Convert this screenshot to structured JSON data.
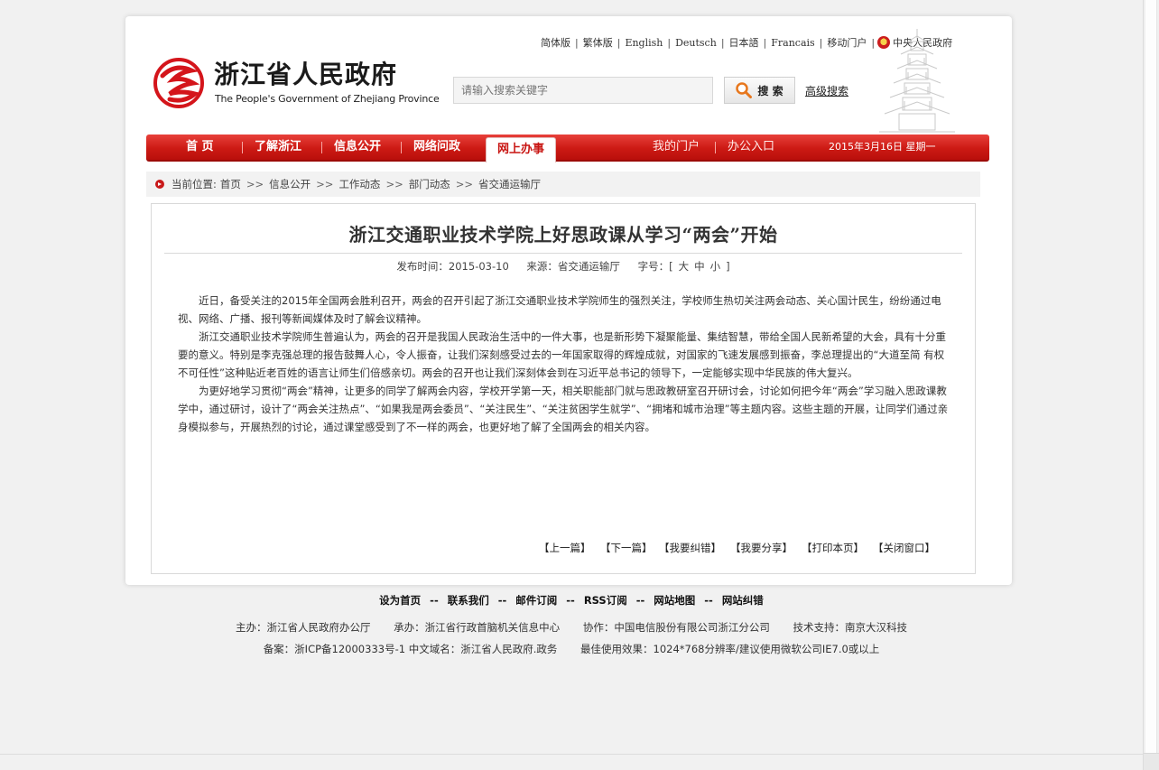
{
  "header": {
    "languages": [
      "简体版",
      "繁体版",
      "English",
      "Deutsch",
      "日本語",
      "Francais",
      "移动门户"
    ],
    "central_gov": "中央人民政府",
    "brand_cn": "浙江省人民政府",
    "brand_en": "The People's Government of Zhejiang Province",
    "search_placeholder": "请输入搜索关键字",
    "search_label": "搜 索",
    "advanced_search": "高级搜索"
  },
  "nav": {
    "items": [
      "首 页",
      "了解浙江",
      "信息公开",
      "网络问政"
    ],
    "active": "网上办事",
    "right_items": [
      "我的门户",
      "办公入口"
    ],
    "date": "2015年3月16日 星期一"
  },
  "breadcrumb": {
    "label": "当前位置:",
    "items": [
      "首页",
      "信息公开",
      "工作动态",
      "部门动态",
      "省交通运输厅"
    ],
    "separator": ">>"
  },
  "article": {
    "title": "浙江交通职业技术学院上好思政课从学习“两会”开始",
    "publish_label": "发布时间：",
    "publish_date": "2015-03-10",
    "source_label": "来源：",
    "source": "省交通运输厅",
    "fontsize_label": "字号：",
    "fontsize_open": "[",
    "fontsize_options": [
      "大",
      "中",
      "小"
    ],
    "fontsize_close": "]",
    "paragraphs": [
      "近日，备受关注的2015年全国两会胜利召开，两会的召开引起了浙江交通职业技术学院师生的强烈关注，学校师生热切关注两会动态、关心国计民生，纷纷通过电视、网络、广播、报刊等新闻媒体及时了解会议精神。",
      "浙江交通职业技术学院师生普遍认为，两会的召开是我国人民政治生活中的一件大事，也是新形势下凝聚能量、集结智慧，带给全国人民新希望的大会，具有十分重要的意义。特别是李克强总理的报告鼓舞人心，令人振奋，让我们深刻感受过去的一年国家取得的辉煌成就，对国家的飞速发展感到振奋，李总理提出的“大道至简 有权不可任性”这种贴近老百姓的语言让师生们倍感亲切。两会的召开也让我们深刻体会到在习近平总书记的领导下，一定能够实现中华民族的伟大复兴。",
      "为更好地学习贯彻“两会”精神，让更多的同学了解两会内容，学校开学第一天，相关职能部门就与思政教研室召开研讨会，讨论如何把今年“两会”学习融入思政课教学中，通过研讨，设计了“两会关注热点”、“如果我是两会委员”、“关注民生”、“关注贫困学生就学”、“拥堵和城市治理”等主题内容。这些主题的开展，让同学们通过亲身模拟参与，开展热烈的讨论，通过课堂感受到了不一样的两会，也更好地了解了全国两会的相关内容。"
    ],
    "actions": [
      "【上一篇】",
      "【下一篇】",
      "【我要纠错】",
      "【我要分享】",
      "【打印本页】",
      "【关闭窗口】"
    ]
  },
  "footer": {
    "links": [
      "设为首页",
      "联系我们",
      "邮件订阅",
      "RSS订阅",
      "网站地图",
      "网站纠错"
    ],
    "link_separator": "--",
    "info_line1": [
      "主办：浙江省人民政府办公厅",
      "承办：浙江省行政首脑机关信息中心",
      "协作：中国电信股份有限公司浙江分公司",
      "技术支持：南京大汉科技"
    ],
    "info_line2": [
      "备案：浙ICP备12000333号-1 中文域名：浙江省人民政府.政务",
      "最佳使用效果：1024*768分辨率/建议使用微软公司IE7.0或以上"
    ]
  },
  "colors": {
    "nav_red": "#cc1a14",
    "active_text": "#c81512",
    "bullet_red": "#c8191a"
  }
}
